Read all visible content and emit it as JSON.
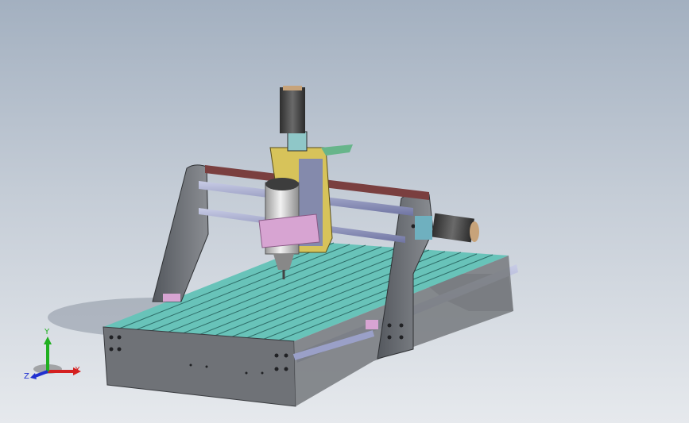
{
  "triad": {
    "x_label": "X",
    "y_label": "Y",
    "z_label": "Z",
    "x_color": "#d42020",
    "y_color": "#20b020",
    "z_color": "#2030d0"
  },
  "scene": {
    "background_top": "#a3b0c0",
    "background_bottom": "#e6e9ed",
    "frame_color": "#6f7277",
    "bed_color": "#68c3b9",
    "rail_color": "#9aa0c8",
    "carriage_color": "#d7c35a",
    "spindle_clamp_color": "#d7a4d2",
    "motor_color": "#4a4a4a"
  }
}
